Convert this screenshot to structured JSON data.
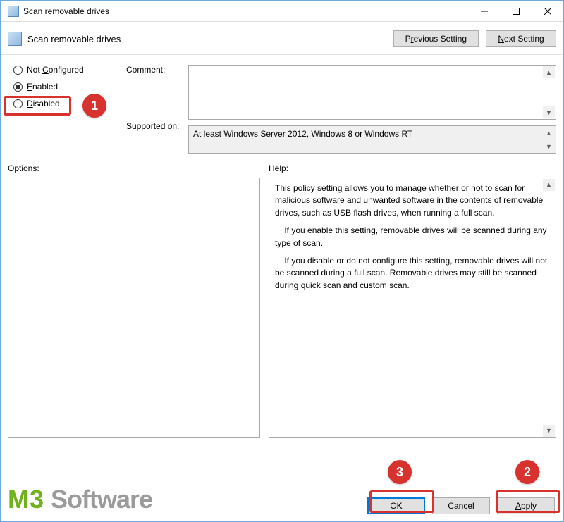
{
  "window": {
    "title": "Scan removable drives"
  },
  "header": {
    "title": "Scan removable drives",
    "prev_btn_pre": "P",
    "prev_btn_u": "r",
    "prev_btn_post": "evious Setting",
    "next_btn_u": "N",
    "next_btn_post": "ext Setting"
  },
  "radios": {
    "not_configured_pre": "Not ",
    "not_configured_u": "C",
    "not_configured_post": "onfigured",
    "enabled_u": "E",
    "enabled_post": "nabled",
    "disabled_u": "D",
    "disabled_post": "isabled",
    "selected": "enabled"
  },
  "labels": {
    "comment": "Comment:",
    "supported": "Supported on:",
    "options": "Options:",
    "help": "Help:"
  },
  "supported_text": "At least Windows Server 2012, Windows 8 or Windows RT",
  "help_text_p1": "This policy setting allows you to manage whether or not to scan for malicious software and unwanted software in the contents of removable drives, such as USB flash drives, when running a full scan.",
  "help_text_p2": "    If you enable this setting, removable drives will be scanned during any type of scan.",
  "help_text_p3": "    If you disable or do not configure this setting, removable drives will not be scanned during a full scan. Removable drives may still be scanned during quick scan and custom scan.",
  "footer": {
    "ok": "OK",
    "cancel": "Cancel",
    "apply_u": "A",
    "apply_post": "pply"
  },
  "callouts": {
    "c1": "1",
    "c2": "2",
    "c3": "3"
  },
  "watermark": {
    "m": "M",
    "three": "3",
    "rest": " Software"
  }
}
